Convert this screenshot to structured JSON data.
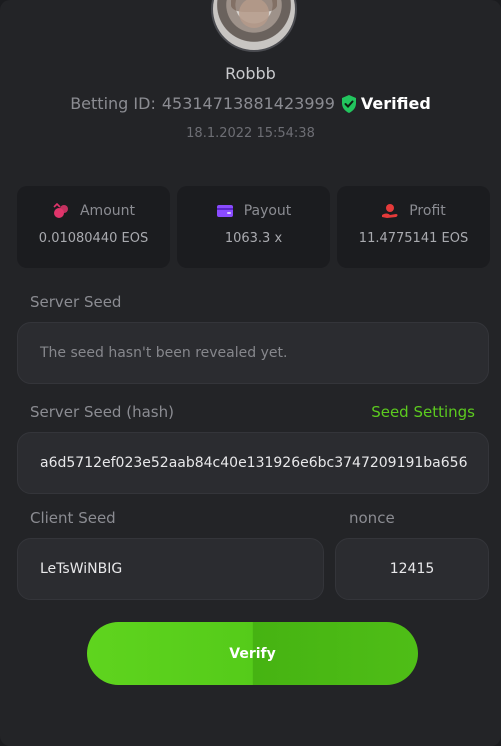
{
  "user": {
    "name": "Robbb",
    "betting_id_label": "Betting ID:",
    "betting_id": "45314713881423999",
    "verified_label": "Verified",
    "timestamp": "18.1.2022 15:54:38"
  },
  "stats": [
    {
      "label": "Amount",
      "value": "0.01080440 EOS",
      "icon": "coins-icon",
      "color": "#e0356b"
    },
    {
      "label": "Payout",
      "value": "1063.3 x",
      "icon": "wallet-icon",
      "color": "#8a4bff"
    },
    {
      "label": "Profit",
      "value": "11.4775141 EOS",
      "icon": "hand-coin-icon",
      "color": "#e53a3a"
    }
  ],
  "server_seed": {
    "label": "Server Seed",
    "placeholder": "The seed hasn't been revealed yet."
  },
  "server_seed_hash": {
    "label": "Server Seed (hash)",
    "settings_link": "Seed Settings",
    "value": "a6d5712ef023e52aab84c40e131926e6bc3747209191ba656"
  },
  "client_seed": {
    "label": "Client Seed",
    "value": "LeTsWiNBIG"
  },
  "nonce": {
    "label": "nonce",
    "value": "12415"
  },
  "verify_label": "Verify",
  "colors": {
    "accent": "#5ccb1f",
    "verified": "#22c55e"
  }
}
